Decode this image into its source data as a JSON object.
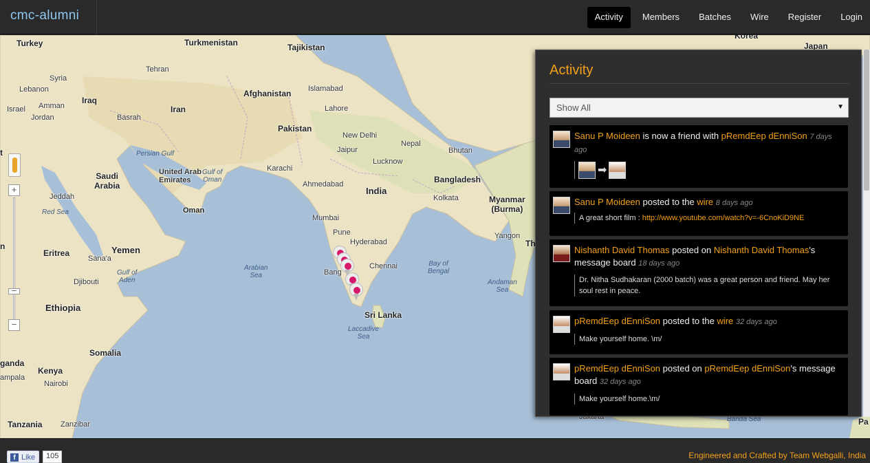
{
  "header": {
    "brand": "cmc-alumni",
    "nav": [
      {
        "label": "Activity",
        "active": true
      },
      {
        "label": "Members"
      },
      {
        "label": "Batches"
      },
      {
        "label": "Wire"
      },
      {
        "label": "Register"
      },
      {
        "label": "Login"
      }
    ]
  },
  "map": {
    "labels": {
      "turkey": "Turkey",
      "turkmenistan": "Turkmenistan",
      "tajikistan": "Tajikistan",
      "korea": "Korea",
      "japan": "Japan",
      "syria": "Syria",
      "lebanon": "Lebanon",
      "iraq": "Iraq",
      "afghanistan": "Afghanistan",
      "islamabad": "Islamabad",
      "tehran": "Tehran",
      "israel": "Israel",
      "amman": "Amman",
      "jordan": "Jordan",
      "iran": "Iran",
      "lahore": "Lahore",
      "basrah": "Basrah",
      "pakistan": "Pakistan",
      "new_delhi": "New Delhi",
      "nepal": "Nepal",
      "bhutan": "Bhutan",
      "persian_gulf": "Persian Gulf",
      "jaipur": "Jaipur",
      "lucknow": "Lucknow",
      "saudi_arabia": "Saudi\nArabia",
      "uae": "United Arab\nEmirates",
      "gulf_oman": "Gulf of\nOman",
      "karachi": "Karachi",
      "india": "India",
      "bangladesh": "Bangladesh",
      "ahmedabad": "Ahmedabad",
      "jeddah": "Jeddah",
      "kolkata": "Kolkata",
      "myanmar": "Myanmar\n(Burma)",
      "oman": "Oman",
      "red_sea": "Red Sea",
      "mumbai": "Mumbai",
      "pune": "Pune",
      "yangon": "Yangon",
      "hyderabad": "Hyderabad",
      "yemen": "Yemen",
      "eritrea": "Eritrea",
      "sanaa": "Sana'a",
      "arabian_sea": "Arabian\nSea",
      "bay_bengal": "Bay of\nBengal",
      "chennai": "Chennai",
      "bangalore": "Bang",
      "gulf_aden": "Gulf of\nAden",
      "djibouti": "Djibouti",
      "andaman_sea": "Andaman\nSea",
      "ethiopia": "Ethiopia",
      "sri_lanka": "Sri Lanka",
      "laccadive": "Laccadive\nSea",
      "somalia": "Somalia",
      "kenya": "Kenya",
      "nairobi": "Nairobi",
      "tanzania": "Tanzania",
      "zanzibar": "Zanzibar",
      "jakarta": "Jakarta",
      "banda_sea": "Banda Sea",
      "th": "Th",
      "pa": "Pa",
      "t_left": "t",
      "n_left": "n",
      "ganda": "ganda",
      "kampala": "ampala"
    },
    "zoom_in": "+",
    "zoom_out": "−"
  },
  "activity": {
    "title": "Activity",
    "filter_value": "Show All",
    "items": [
      {
        "actor": "Sanu P Moideen",
        "verb": " is now a friend with ",
        "target": "pRemdEep dEnniSon",
        "time": "7 days ago",
        "kind": "friend"
      },
      {
        "actor": "Sanu P Moideen",
        "verb": " posted to the ",
        "target": "wire",
        "time": "8 days ago",
        "body_prefix": "A great short film : ",
        "body_link": "http://www.youtube.com/watch?v=-6CnoKiD9NE"
      },
      {
        "actor": "Nishanth David Thomas",
        "verb": " posted on ",
        "target": "Nishanth David Thomas",
        "suffix": "'s message board",
        "time": "18 days ago",
        "body": "Dr. Nitha Sudhakaran (2000 batch) was a great person and friend. May her soul rest in peace."
      },
      {
        "actor": "pRemdEep dEnniSon",
        "verb": " posted to the ",
        "target": "wire",
        "time": "32 days ago",
        "body": "Make yourself home. \\m/"
      },
      {
        "actor": "pRemdEep dEnniSon",
        "verb": " posted on ",
        "target": "pRemdEep dEnniSon",
        "suffix": "'s message board",
        "time": "32 days ago",
        "body": "Make yourself home.\\m/"
      }
    ]
  },
  "footer": {
    "like_label": "Like",
    "like_count": "105",
    "credit": "Engineered and Crafted by Team Webgalli, India"
  },
  "colors": {
    "accent": "#f3a018",
    "land": "#ece3c4",
    "water": "#a8bfd8"
  }
}
